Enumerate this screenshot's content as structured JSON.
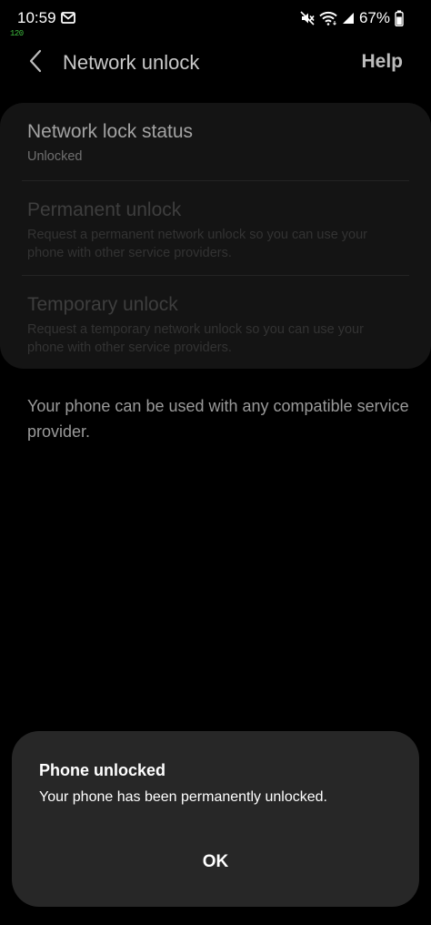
{
  "status_bar": {
    "time": "10:59",
    "refresh_rate": "120",
    "battery_percent": "67%",
    "icons": {
      "notification": "mail-icon",
      "mute": "mute-icon",
      "wifi": "wifi-icon",
      "signal": "signal-icon",
      "battery": "battery-icon"
    }
  },
  "app_bar": {
    "title": "Network unlock",
    "help_label": "Help",
    "back_icon": "chevron-left-icon"
  },
  "settings": {
    "items": [
      {
        "title": "Network lock status",
        "subtitle": "Unlocked"
      },
      {
        "title": "Permanent unlock",
        "subtitle": "Request a permanent network unlock so you can use your phone with other service providers."
      },
      {
        "title": "Temporary unlock",
        "subtitle": "Request a temporary network unlock so you can use your phone with other service providers."
      }
    ]
  },
  "info": {
    "text": "Your phone can be used with any compatible service provider."
  },
  "dialog": {
    "title": "Phone unlocked",
    "message": "Your phone has been permanently unlocked.",
    "ok_label": "OK"
  }
}
